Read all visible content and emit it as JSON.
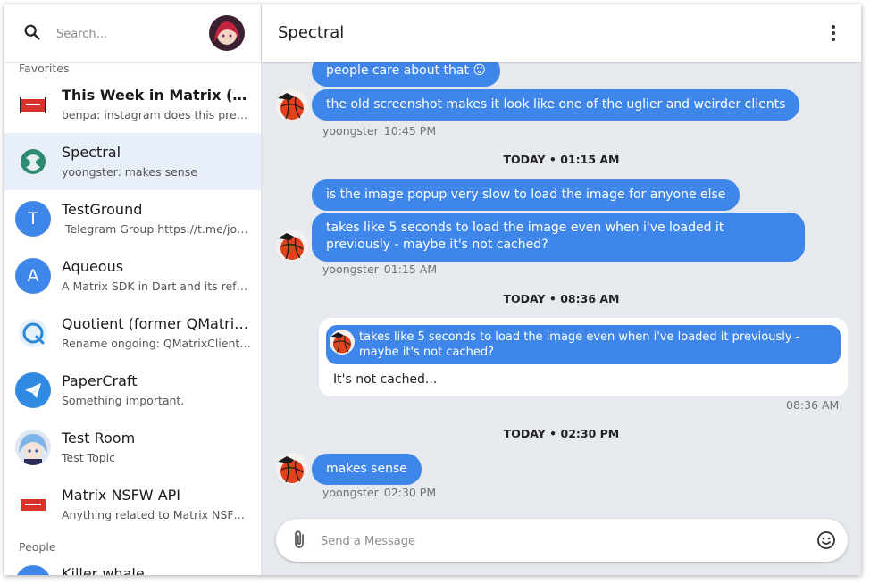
{
  "colors": {
    "accent": "#3f86ea",
    "active_room": "#e8eff9",
    "timeline_bg": "#e6e9ee"
  },
  "search": {
    "placeholder": "Search..."
  },
  "sidebar": {
    "favorites_label": "Favorites",
    "people_label": "People",
    "rooms": [
      {
        "name": "This Week in Matrix (TWIM)",
        "preview": "benpa: instagram does this pretty well",
        "avatar": "twim-logo",
        "bold": true
      },
      {
        "name": "Spectral",
        "preview": "yoongster: makes sense",
        "avatar": "spectral-logo",
        "active": true
      },
      {
        "name": "TestGround",
        "preview": " Telegram Group https://t.me/joinchat",
        "avatar_letter": "T"
      },
      {
        "name": "Aqueous",
        "preview": "A Matrix SDK in Dart and its reference client",
        "avatar_letter": "A"
      },
      {
        "name": "Quotient (former QMatrixClient)",
        "preview": "Rename ongoing: QMatrixClient → Quotient",
        "avatar": "quotient-logo"
      },
      {
        "name": "PaperCraft",
        "preview": "Something important.",
        "avatar": "paper-plane-logo"
      },
      {
        "name": "Test Room",
        "preview": "Test Topic",
        "avatar": "anime-avatar"
      },
      {
        "name": "Matrix NSFW API",
        "preview": "Anything related to Matrix NSFW API",
        "avatar": "nsfw-logo"
      },
      {
        "name": "Killer whale",
        "preview": ""
      }
    ]
  },
  "room": {
    "title": "Spectral"
  },
  "timeline": {
    "group1": {
      "messages": [
        "people care about that 😛",
        "the old screenshot makes it look like one of the uglier and weirder clients"
      ],
      "sender": "yoongster",
      "time": "10:45 PM"
    },
    "sep1": "TODAY • 01:15 AM",
    "group2": {
      "messages": [
        "is the image popup very slow to load the image for anyone else",
        "takes like 5 seconds to load the image even when i've loaded it previously - maybe it's not cached?"
      ],
      "sender": "yoongster",
      "time": "01:15 AM"
    },
    "sep2": "TODAY • 08:36 AM",
    "reply": {
      "quote": "takes like 5 seconds to load the image even when i've loaded it previously - maybe it's not cached?",
      "text": "It's not cached...",
      "time": "08:36 AM"
    },
    "sep3": "TODAY • 02:30 PM",
    "group3": {
      "messages": [
        "makes sense"
      ],
      "sender": "yoongster",
      "time": "02:30 PM"
    }
  },
  "composer": {
    "placeholder": "Send a Message"
  }
}
